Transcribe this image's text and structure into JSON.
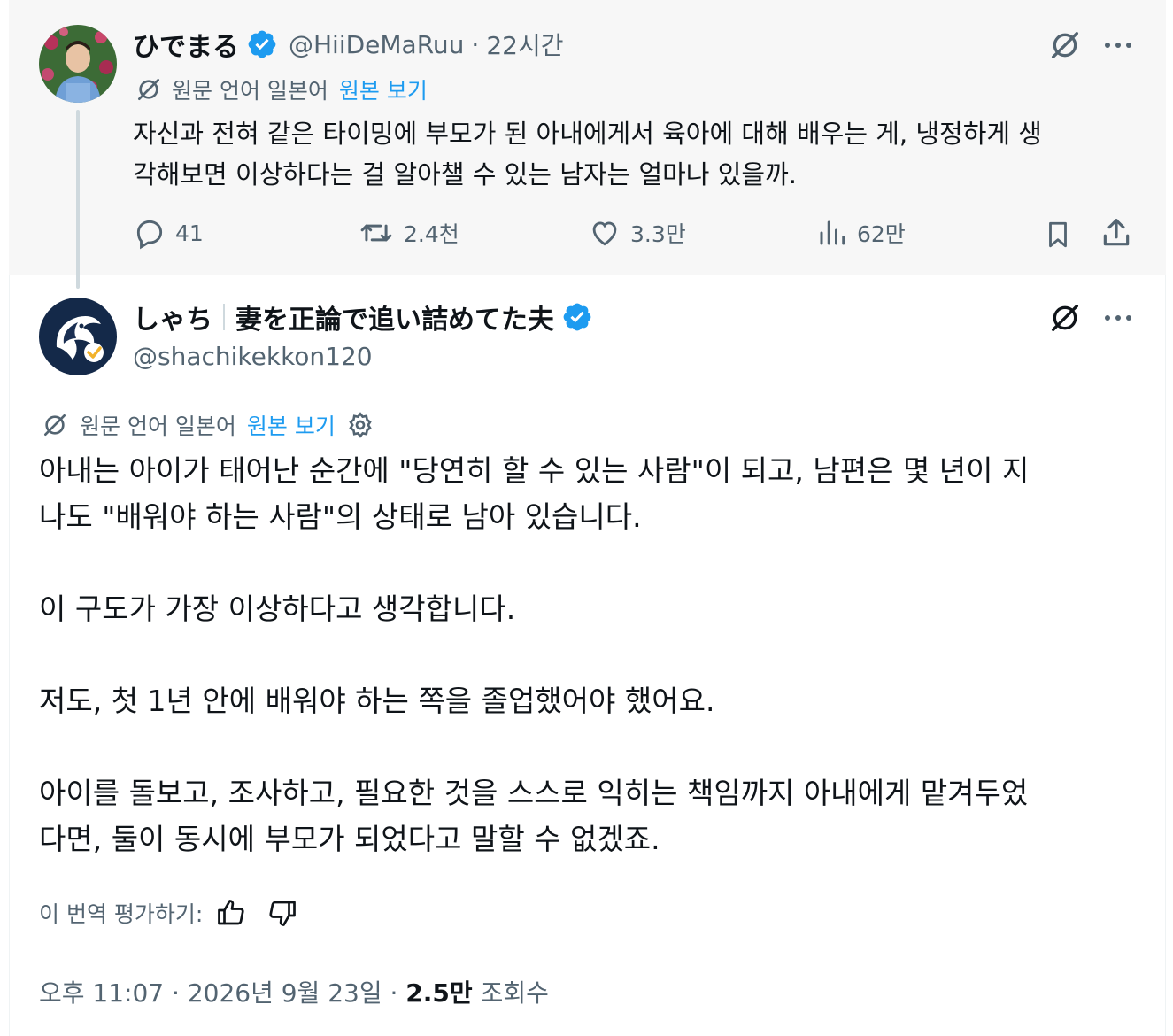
{
  "colors": {
    "accent": "#1d9bf0",
    "muted": "#536471",
    "text": "#0f1419",
    "verified": "#1d9bf0"
  },
  "parent_tweet": {
    "author_name": "ひでまる",
    "handle": "@HiiDeMaRuu",
    "separator": "·",
    "time": "22시간",
    "translation_note": "원문 언어 일본어",
    "show_original": "원본 보기",
    "text_lines": [
      "자신과 전혀 같은 타이밍에 부모가 된 아내에게서 육아에 대해 배우는 게, 냉정하게 생",
      "각해보면 이상하다는 걸 알아챌 수 있는 남자는 얼마나 있을까."
    ],
    "actions": {
      "replies": "41",
      "reposts": "2.4천",
      "likes": "3.3만",
      "views": "62만"
    },
    "icons": [
      "verified-icon",
      "grok-icon",
      "more-icon",
      "reply-icon",
      "repost-icon",
      "like-icon",
      "views-icon",
      "bookmark-icon",
      "share-icon"
    ]
  },
  "main_tweet": {
    "author_name": "しゃち",
    "author_bio": "妻を正論で追い詰めてた夫",
    "handle": "@shachikekkon120",
    "translation_note": "원문 언어 일본어",
    "show_original": "원본 보기",
    "lines": [
      "아내는 아이가 태어난 순간에 \"당연히 할 수 있는 사람\"이 되고, 남편은 몇 년이 지",
      "나도 \"배워야 하는 사람\"의 상태로 남아 있습니다.",
      "이 구도가 가장 이상하다고 생각합니다.",
      "저도, 첫 1년 안에 배워야 하는 쪽을 졸업했어야 했어요.",
      "아이를 돌보고, 조사하고, 필요한 것을 스스로 익히는 책임까지 아내에게 맡겨두었",
      "다면, 둘이 동시에 부모가 되었다고 말할 수 없겠죠."
    ],
    "rate_translation": "이 번역 평가하기:",
    "timestamp": "오후 11:07 · 2026년 9월 23일 · ",
    "views_count": "2.5만",
    "views_label": " 조회수"
  }
}
